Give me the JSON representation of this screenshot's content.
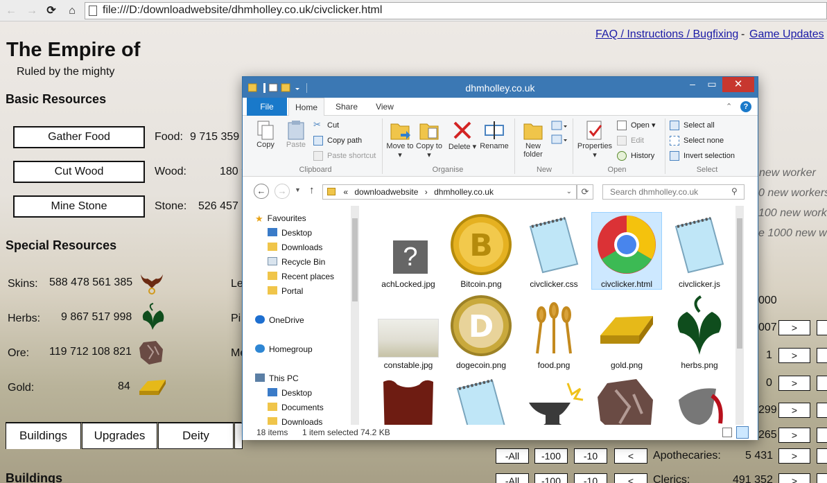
{
  "browser": {
    "url": "file:///D:/downloadwebsite/dhmholley.co.uk/civclicker.html"
  },
  "header_links": {
    "faq": "FAQ / Instructions / Bugfixing",
    "dash": "-",
    "updates": "Game Updates"
  },
  "empire": {
    "title": "The Empire of",
    "ruler": "Ruled by the mighty"
  },
  "basic": {
    "heading": "Basic Resources",
    "rows": [
      {
        "button": "Gather Food",
        "label": "Food:",
        "value": "9 715 359 8"
      },
      {
        "button": "Cut Wood",
        "label": "Wood:",
        "value": "180 9"
      },
      {
        "button": "Mine Stone",
        "label": "Stone:",
        "value": "526 457 8"
      }
    ]
  },
  "special": {
    "heading": "Special Resources",
    "rows": [
      {
        "label": "Skins:",
        "value": "588 478 561 385",
        "icon": "skins-icon",
        "right_label": "Le"
      },
      {
        "label": "Herbs:",
        "value": "9 867 517 998",
        "icon": "herbs-icon",
        "right_label": "Pi"
      },
      {
        "label": "Ore:",
        "value": "119 712 108 821",
        "icon": "ore-icon",
        "right_label": "Me"
      },
      {
        "label": "Gold:",
        "value": "84",
        "icon": "gold-icon",
        "right_label": ""
      }
    ]
  },
  "tabs": [
    "Buildings",
    "Upgrades",
    "Deity"
  ],
  "buildings_heading": "Buildings",
  "right_panel": {
    "workers": [
      "new worker",
      "0 new workers",
      "100 new work",
      "e 1000 new wo"
    ],
    "numbers": [
      "000",
      "007",
      "1",
      "0",
      "299",
      "265"
    ],
    "arrow": ">",
    "rows": [
      {
        "all": "-All",
        "m100": "-100",
        "m10": "-10",
        "lt": "<",
        "label": "Apothecaries:",
        "value": "5 431",
        "gt": ">"
      },
      {
        "all": "-All",
        "m100": "-100",
        "m10": "-10",
        "lt": "<",
        "label": "Clerics:",
        "value": "491 352",
        "gt": ">"
      }
    ]
  },
  "explorer": {
    "title": "dhmholley.co.uk",
    "close": "✕",
    "minimize": "–",
    "maximize": "▭",
    "ribbon_tabs": [
      "File",
      "Home",
      "Share",
      "View"
    ],
    "clipboard": {
      "copy": "Copy",
      "paste": "Paste",
      "cut": "Cut",
      "copy_path": "Copy path",
      "paste_shortcut": "Paste shortcut",
      "group": "Clipboard"
    },
    "organise": {
      "move_to": "Move to ▾",
      "copy_to": "Copy to ▾",
      "delete": "Delete ▾",
      "rename": "Rename",
      "group": "Organise"
    },
    "new": {
      "new_folder": "New folder",
      "group": "New"
    },
    "open": {
      "properties": "Properties ▾",
      "open": "Open ▾",
      "edit": "Edit",
      "history": "History",
      "group": "Open"
    },
    "select": {
      "all": "Select all",
      "none": "Select none",
      "invert": "Invert selection",
      "group": "Select"
    },
    "path": [
      "«",
      "downloadwebsite",
      "›",
      "dhmholley.co.uk"
    ],
    "search_placeholder": "Search dhmholley.co.uk",
    "nav": [
      "Favourites",
      "Desktop",
      "Downloads",
      "Recycle Bin",
      "Recent places",
      "Portal",
      "OneDrive",
      "Homegroup",
      "This PC",
      "Desktop",
      "Documents",
      "Downloads"
    ],
    "files": [
      "achLocked.jpg",
      "Bitcoin.png",
      "civclicker.css",
      "civclicker.html",
      "civclicker.js",
      "constable.jpg",
      "dogecoin.png",
      "food.png",
      "gold.png",
      "herbs.png",
      "",
      "",
      "",
      "",
      ""
    ],
    "status": {
      "count": "18 items",
      "selected": "1 item selected",
      "size": "74.2 KB"
    }
  },
  "colors": {
    "explorer_titlebar": "#3b78b4",
    "close_button": "#c7372f",
    "link": "#1a1aa6",
    "file_tab": "#1979ca"
  }
}
